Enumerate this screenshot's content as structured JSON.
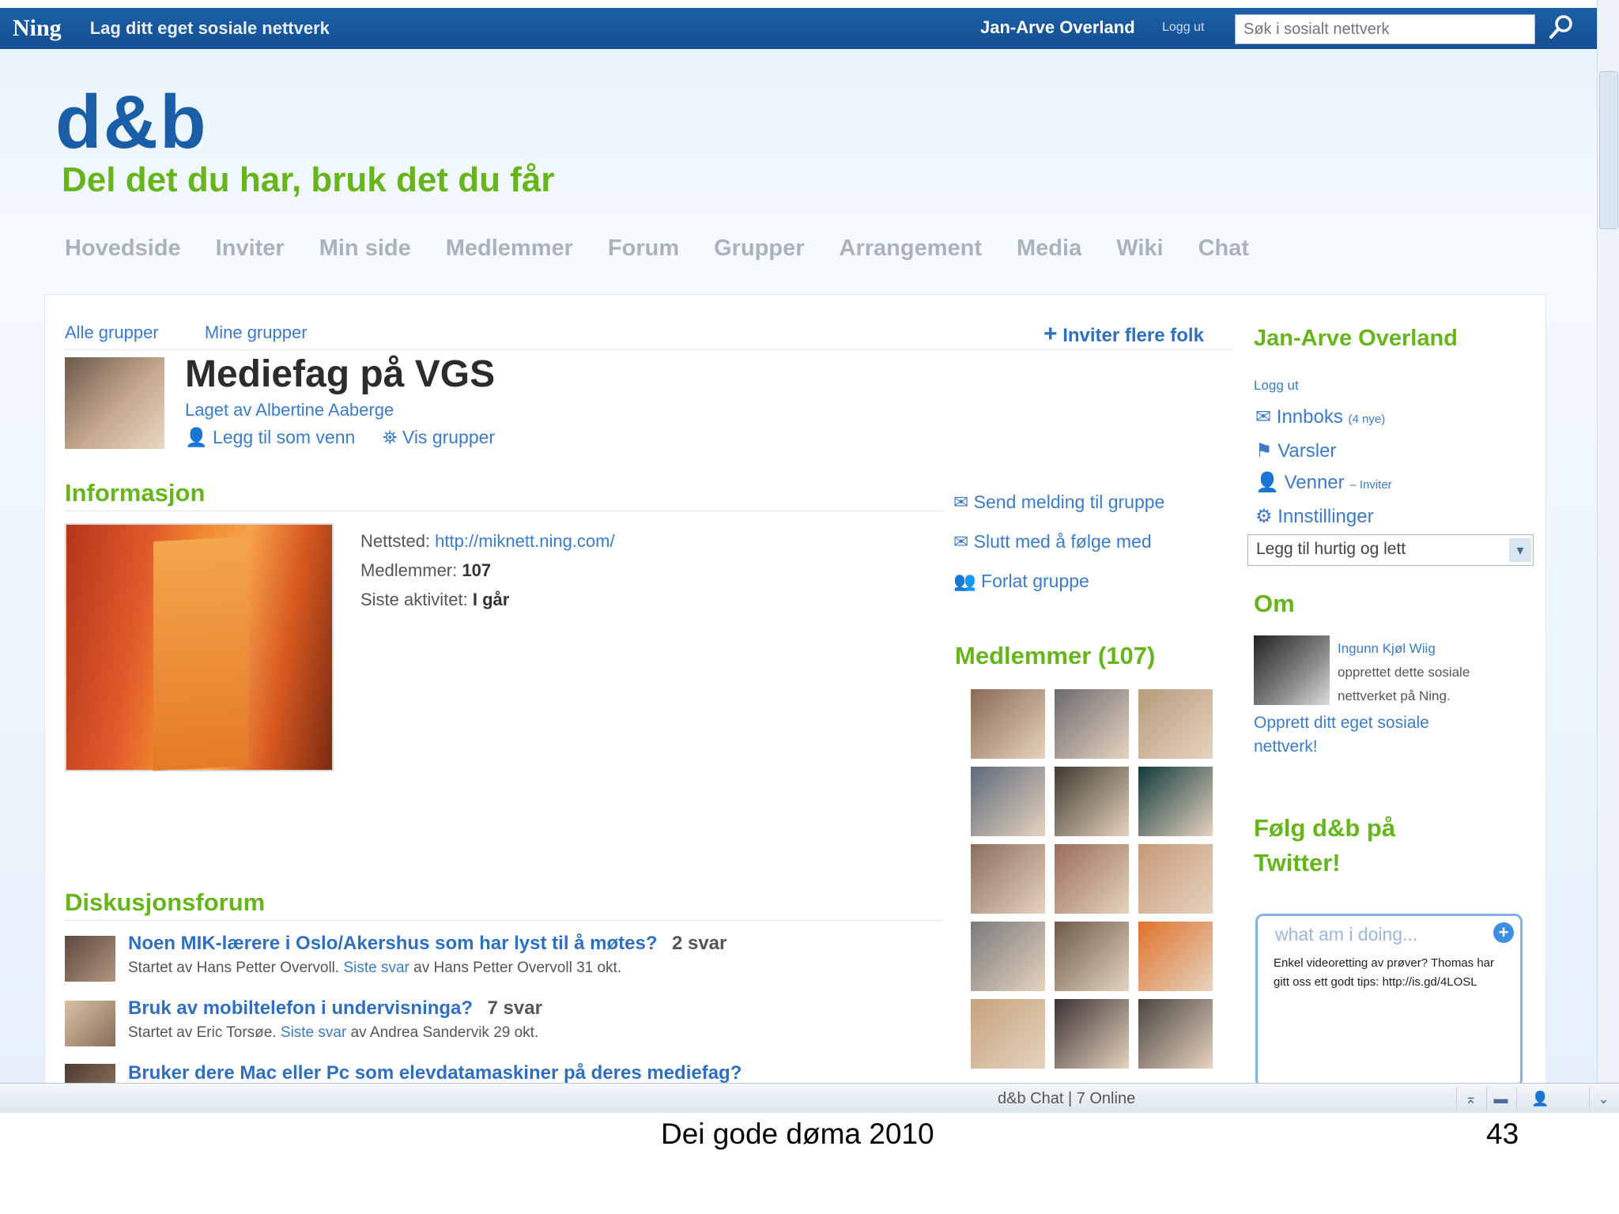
{
  "topbar": {
    "logo": "Ning",
    "tagline": "Lag ditt eget sosiale nettverk",
    "user": "Jan-Arve Overland",
    "logout": "Logg ut",
    "search_placeholder": "Søk i sosialt nettverk",
    "search_icon": "search-icon"
  },
  "header": {
    "logo": "d&b",
    "slogan": "Del det du har, bruk det du får",
    "brand_blue": "#1b5ea8",
    "brand_green": "#67b51c"
  },
  "nav": [
    "Hovedside",
    "Inviter",
    "Min side",
    "Medlemmer",
    "Forum",
    "Grupper",
    "Arrangement",
    "Media",
    "Wiki",
    "Chat"
  ],
  "subtabs": {
    "all": "Alle grupper",
    "mine": "Mine grupper",
    "invite": "Inviter flere folk"
  },
  "group": {
    "title": "Mediefag på VGS",
    "creator": "Laget av Albertine Aaberge",
    "add_friend": "Legg til som venn",
    "view_groups": "Vis grupper"
  },
  "info": {
    "heading": "Informasjon",
    "website_label": "Nettsted:",
    "website": "http://miknett.ning.com/",
    "members_label": "Medlemmer:",
    "members": "107",
    "activity_label": "Siste aktivitet:",
    "activity": "I går"
  },
  "group_links": [
    "Send melding til gruppe",
    "Slutt med å følge med",
    "Forlat gruppe"
  ],
  "members": {
    "heading": "Medlemmer (107)",
    "avatar_colors": [
      "#8a6a55",
      "#6c6a6e",
      "#b79b7c",
      "#5d6a7a",
      "#3f3a2e",
      "#123a3b",
      "#8b6f5e",
      "#9a6d5b",
      "#c79a78",
      "#7b7b7b",
      "#6e5a4a",
      "#e0722c",
      "#c7a37c",
      "#3c3234",
      "#4a4440"
    ]
  },
  "forum": {
    "heading": "Diskusjonsforum",
    "topics": [
      {
        "title": "Noen MIK-lærere i Oslo/Akershus som har lyst til å møtes?",
        "replies": "2 svar",
        "meta_start": "Startet av Hans Petter Overvoll.",
        "meta_link": "Siste svar",
        "meta_end": "av Hans Petter Overvoll 31 okt."
      },
      {
        "title": "Bruk av mobiltelefon i undervisninga?",
        "replies": "7 svar",
        "meta_start": "Startet av Eric Torsøe.",
        "meta_link": "Siste svar",
        "meta_end": "av Andrea Sandervik 29 okt."
      },
      {
        "title": "Bruker dere Mac eller Pc som elevdatamaskiner på deres mediefag?",
        "replies": "",
        "meta_start": "",
        "meta_link": "",
        "meta_end": ""
      }
    ]
  },
  "sidebar": {
    "name": "Jan-Arve Overland",
    "logout": "Logg ut",
    "inbox": "Innboks",
    "inbox_new": "(4 nye)",
    "alerts": "Varsler",
    "friends": "Venner",
    "friends_invite": "– Inviter",
    "settings": "Innstillinger",
    "quick_add": "Legg til hurtig og lett",
    "about_heading": "Om",
    "creator_line1": "Ingunn Kjøl Wiig",
    "creator_line2": "opprettet dette sosiale",
    "creator_line3": "nettverket på Ning.",
    "create_link_1": "Opprett ditt eget sosiale",
    "create_link_2": "nettverk!",
    "twitter_line1": "Følg d&b på",
    "twitter_line2": "Twitter!",
    "twitter_placeholder": "what am i doing...",
    "twitter_plus": "+",
    "tweet": "Enkel videoretting av prøver? Thomas har gitt oss ett godt tips: http://is.gd/4LOSL"
  },
  "chatbar": {
    "label": "d&b Chat | 7 Online"
  },
  "footer": {
    "left": "Dei gode døma 2010",
    "page": "43"
  }
}
